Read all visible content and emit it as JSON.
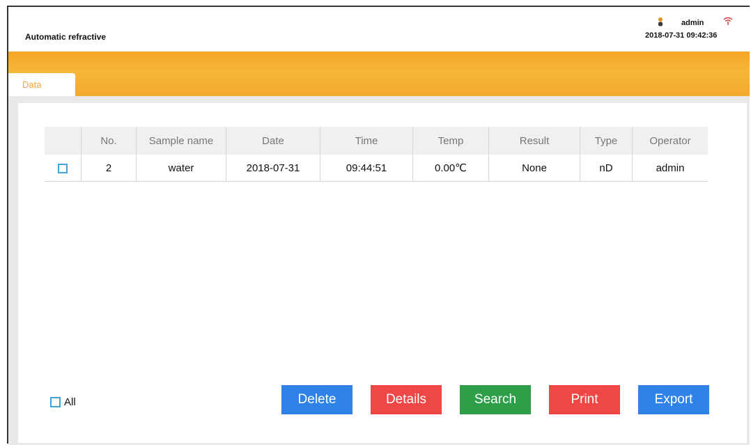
{
  "header": {
    "app_title": "Automatic refractive",
    "username": "admin",
    "datetime": "2018-07-31 09:42:36"
  },
  "tabs": [
    {
      "label": "Data",
      "active": true
    }
  ],
  "table": {
    "columns": [
      "No.",
      "Sample name",
      "Date",
      "Time",
      "Temp",
      "Result",
      "Type",
      "Operator"
    ],
    "rows": [
      {
        "no": "2",
        "sample_name": "water",
        "date": "2018-07-31",
        "time": "09:44:51",
        "temp": "0.00℃",
        "result": "None",
        "type": "nD",
        "operator": "admin",
        "checked": false
      }
    ]
  },
  "footer": {
    "select_all_label": "All",
    "buttons": {
      "delete": "Delete",
      "details": "Details",
      "search": "Search",
      "print": "Print",
      "export": "Export"
    }
  },
  "colors": {
    "accent_orange": "#f6a623",
    "checkbox_blue": "#3fa3d8",
    "delete_blue": "#2f83e8",
    "details_red": "#ef4646",
    "search_green": "#2e9e48",
    "print_red": "#ef4646",
    "export_blue": "#2f83e8"
  },
  "icons": {
    "user": "person-icon",
    "network": "wifi-icon"
  }
}
